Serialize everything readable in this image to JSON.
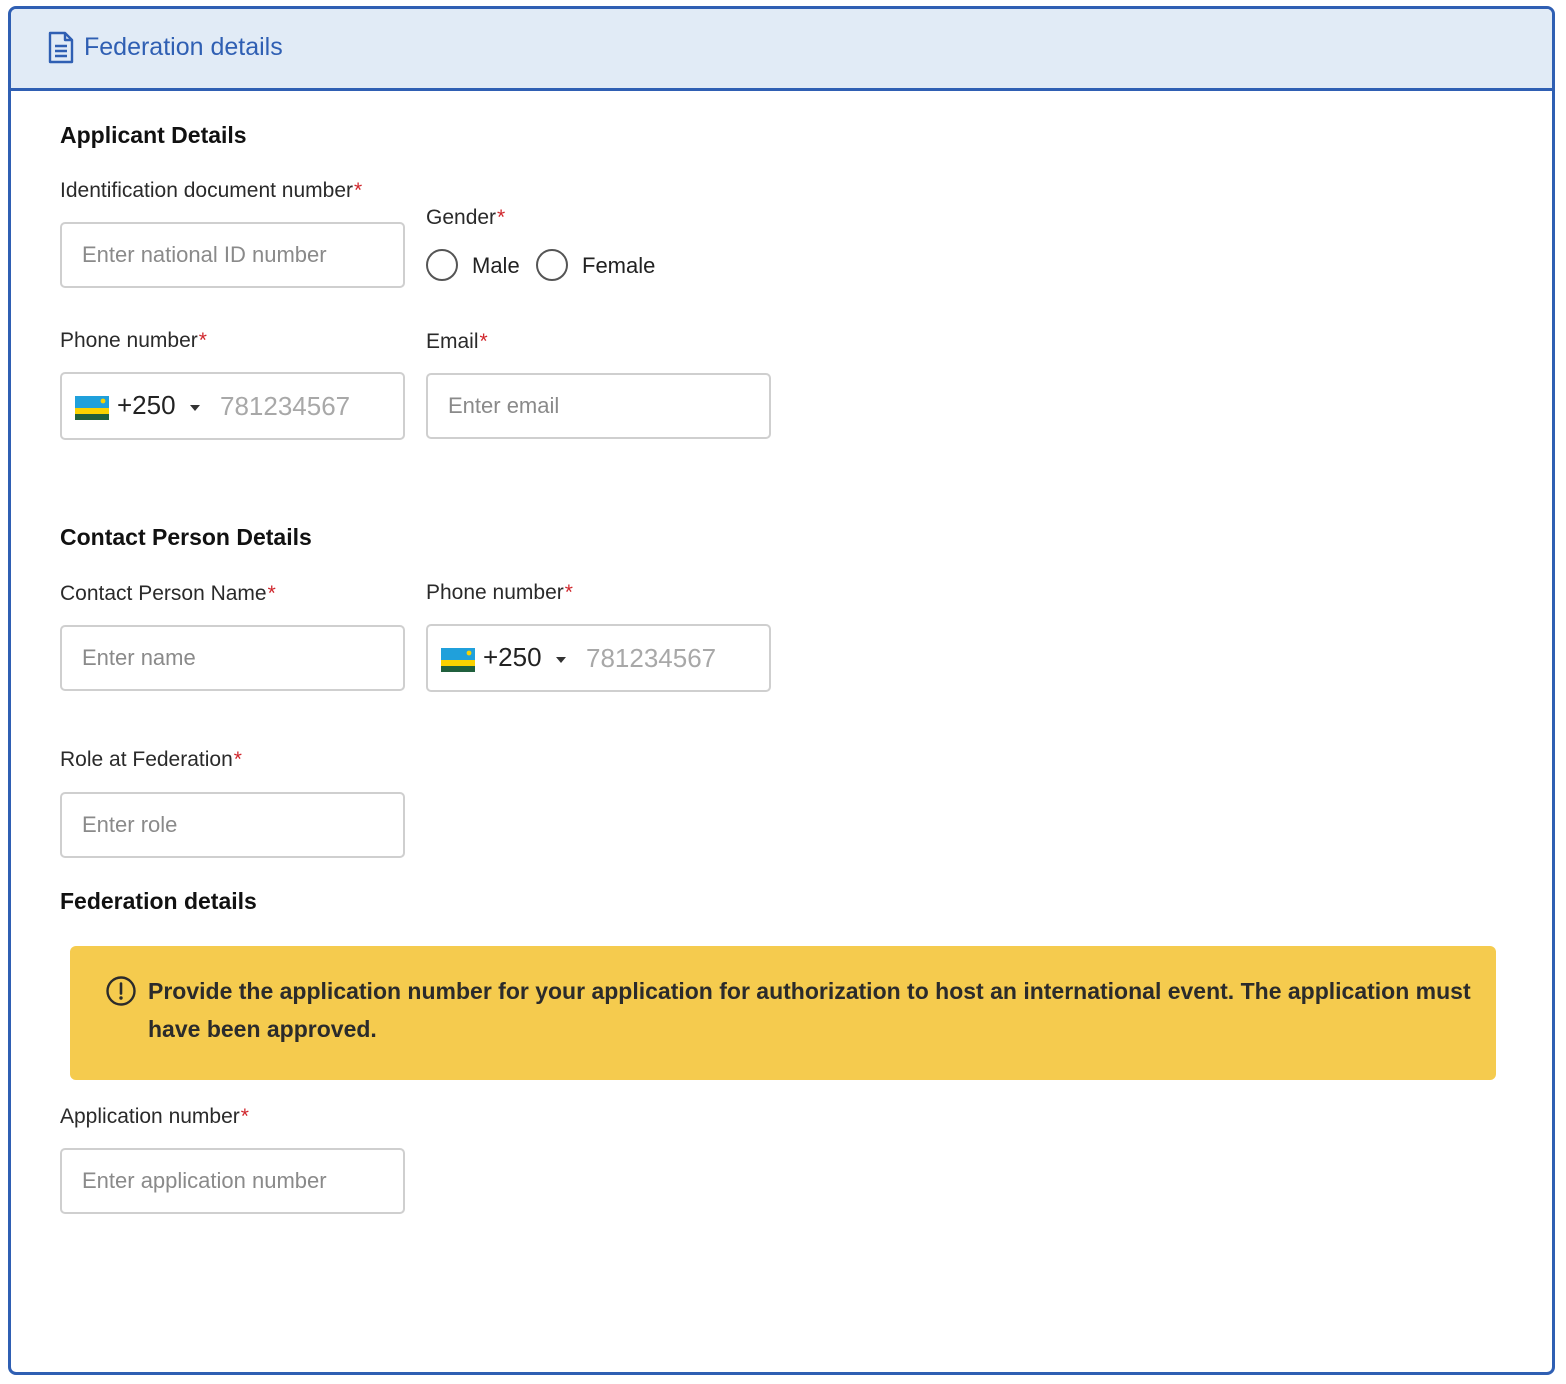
{
  "card": {
    "title": "Federation details"
  },
  "applicant": {
    "section_title": "Applicant Details",
    "id_label": "Identification document number",
    "id_placeholder": "Enter national ID number",
    "gender_label": "Gender",
    "gender_options": [
      "Male",
      "Female"
    ],
    "phone_label": "Phone number",
    "phone_code": "+250",
    "phone_placeholder": "781234567",
    "email_label": "Email",
    "email_placeholder": "Enter email"
  },
  "contact": {
    "section_title": "Contact Person Details",
    "name_label": "Contact Person Name",
    "name_placeholder": "Enter name",
    "phone_label": "Phone number",
    "phone_code": "+250",
    "phone_placeholder": "781234567",
    "role_label": "Role at Federation",
    "role_placeholder": "Enter role"
  },
  "federation": {
    "section_title": "Federation details",
    "alert_text": "Provide the application number for your application for authorization to host an international event. The application must have been approved.",
    "app_number_label": "Application number",
    "app_number_placeholder": "Enter application number"
  },
  "required_marker": "*",
  "colors": {
    "accent": "#2f5fb3",
    "header_bg": "#e1ebf6",
    "required": "#d0262c",
    "alert_bg": "#f5cb4e",
    "input_border": "#cfcfcf"
  },
  "icons": {
    "header": "document-icon",
    "alert": "info-circle-icon",
    "flag": "rwanda-flag-icon",
    "dropdown": "caret-down-icon"
  }
}
